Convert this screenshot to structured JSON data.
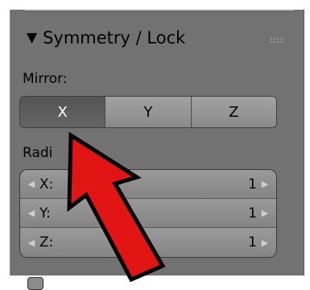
{
  "panel": {
    "title": "Symmetry / Lock",
    "collapse_icon": "triangle-down-icon",
    "grip_icon": "drag-grip-icon"
  },
  "mirror": {
    "label": "Mirror:",
    "options": [
      "X",
      "Y",
      "Z"
    ],
    "active": "X"
  },
  "radial": {
    "label": "Radi",
    "fields": [
      {
        "name": "X:",
        "value": "1"
      },
      {
        "name": "Y:",
        "value": "1"
      },
      {
        "name": "Z:",
        "value": "1"
      }
    ]
  },
  "annotation": {
    "arrow_color": "#e31414",
    "arrow_outline": "#000000"
  }
}
